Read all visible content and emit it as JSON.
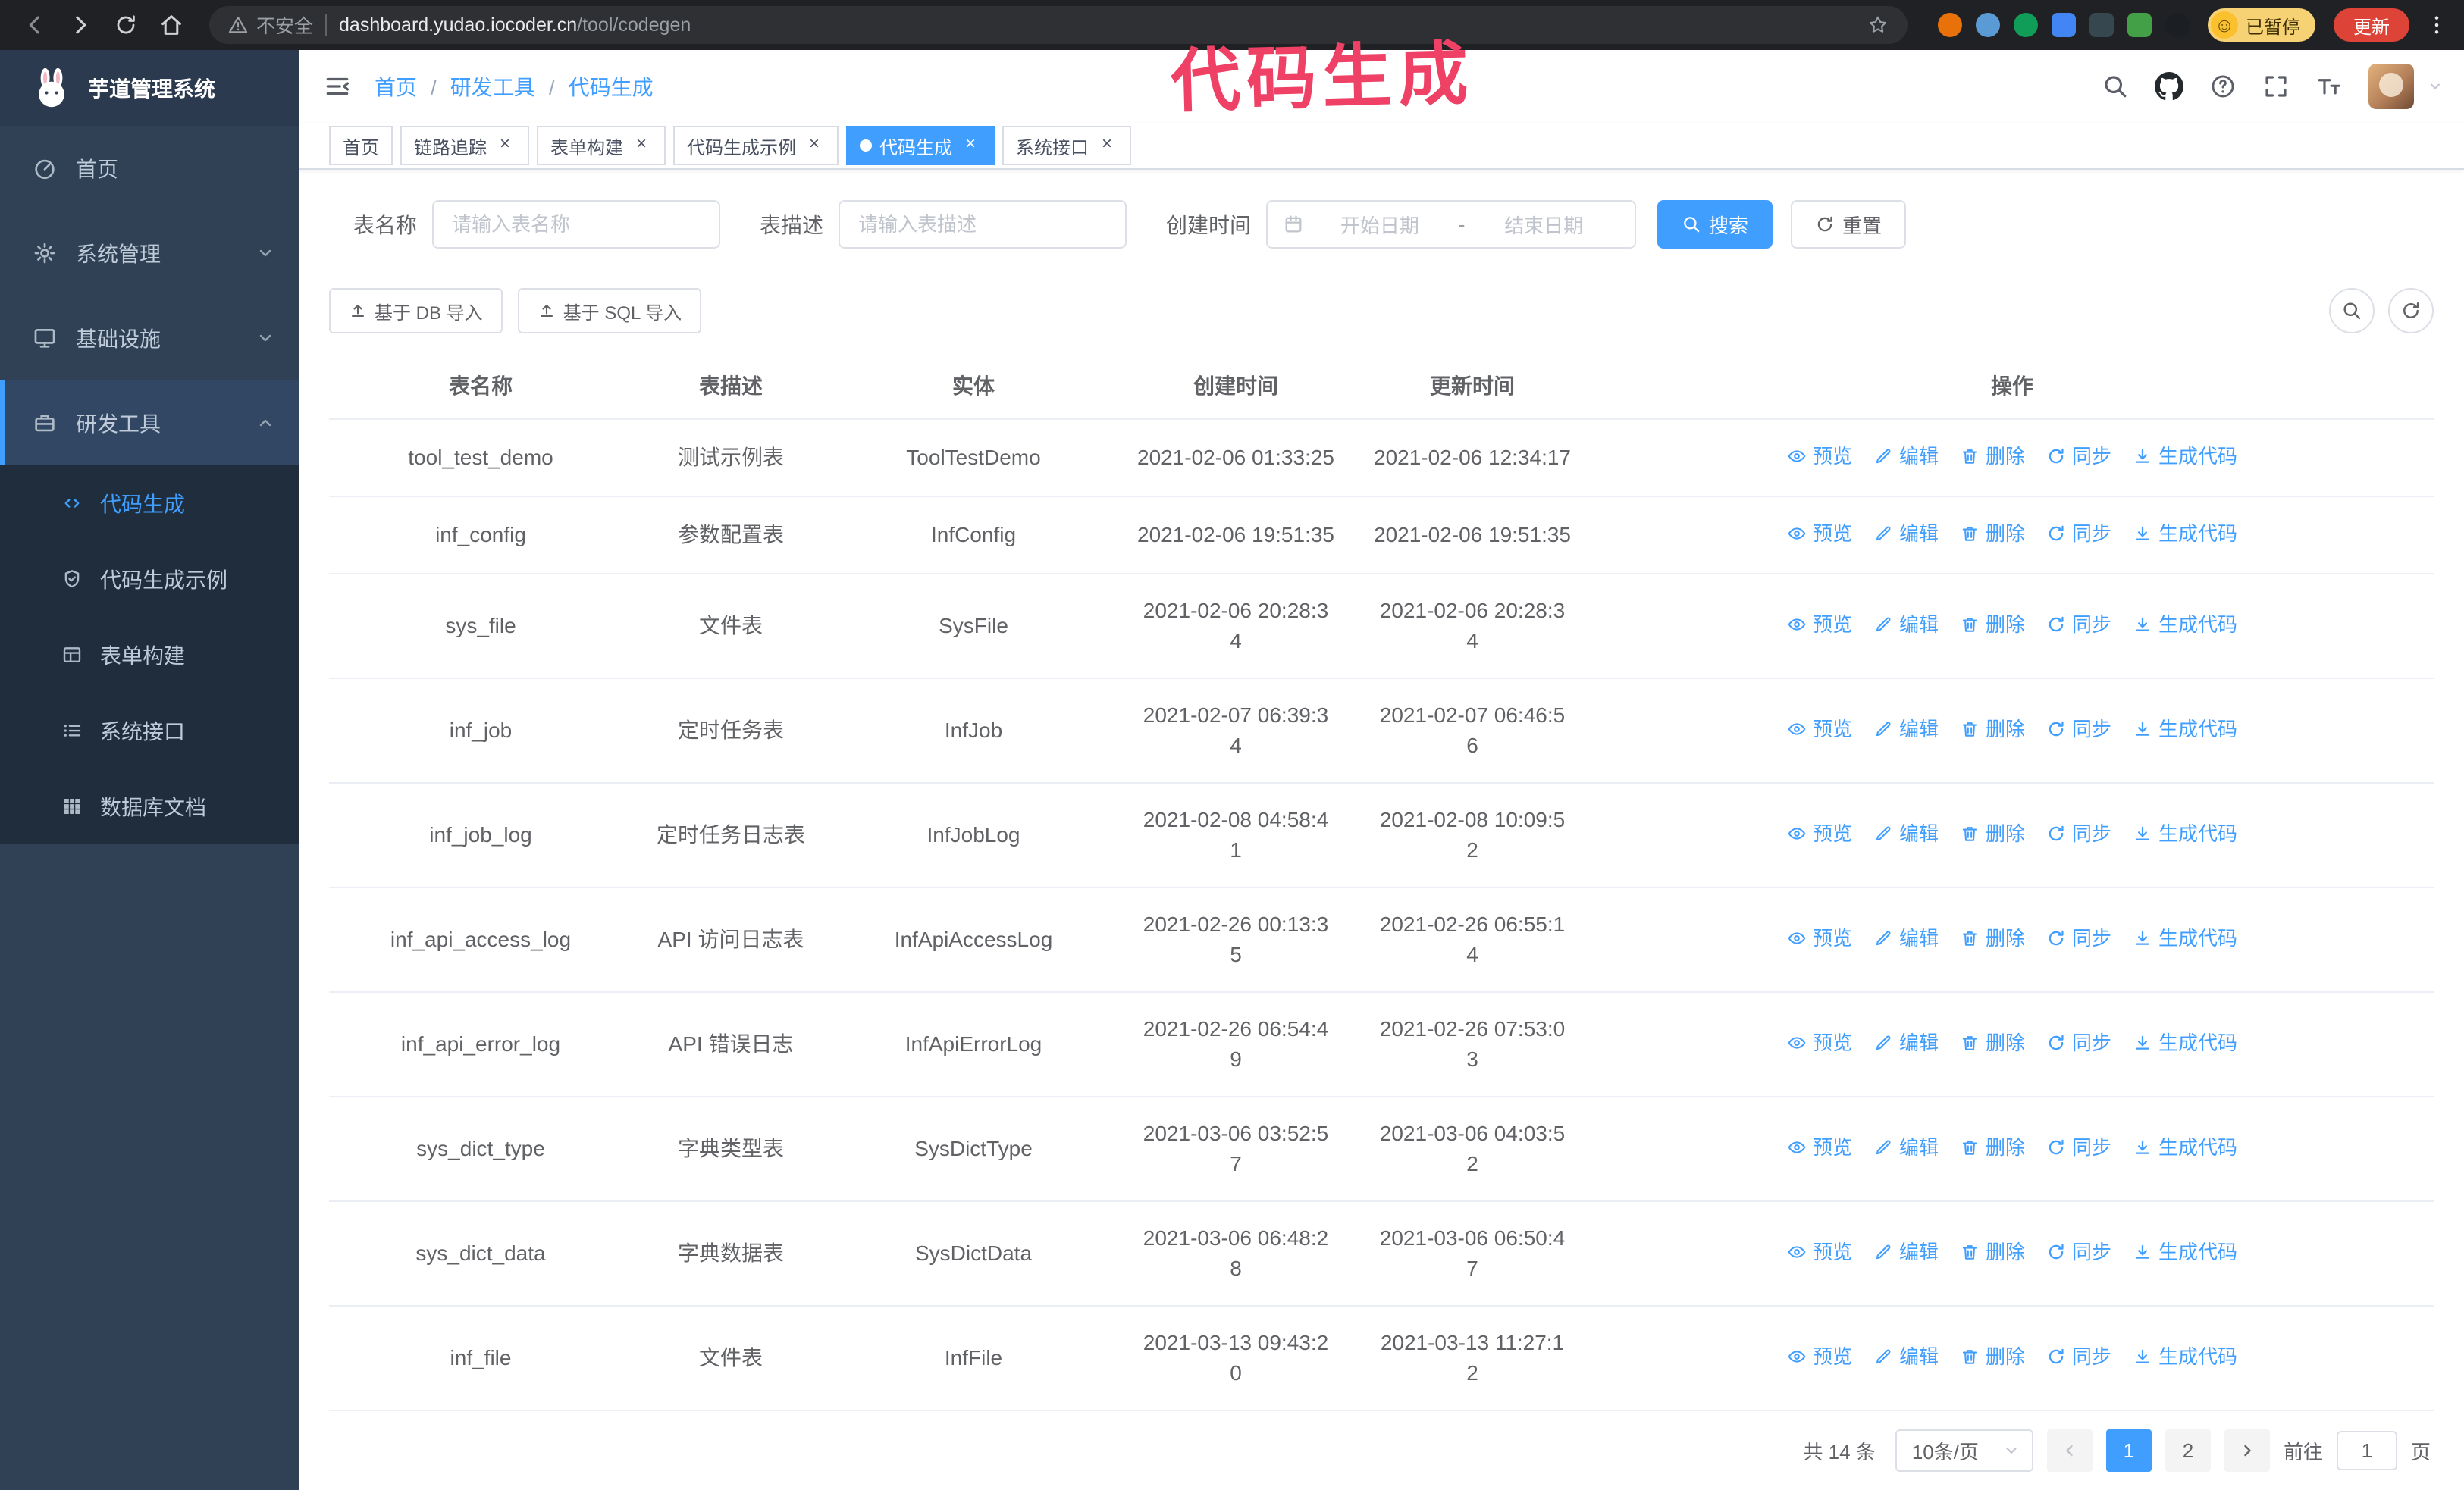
{
  "browser": {
    "security_label": "不安全",
    "url_host": "dashboard.yudao.iocoder.cn",
    "url_path": "/tool/codegen",
    "paused_badge": "已暂停",
    "update_button": "更新",
    "extensions": [
      {
        "name": "fox",
        "color": "#e8710a",
        "shape": "circle"
      },
      {
        "name": "drop",
        "color": "#5b9bd5",
        "shape": "circle"
      },
      {
        "name": "check",
        "color": "#0f9d58",
        "shape": "circle"
      },
      {
        "name": "people",
        "color": "#4285f4",
        "shape": "square"
      },
      {
        "name": "dark",
        "color": "#37474f",
        "shape": "square"
      },
      {
        "name": "leaf",
        "color": "#43a047",
        "shape": "square"
      },
      {
        "name": "knot",
        "color": "#1b1f23",
        "shape": "circle"
      }
    ]
  },
  "annotation": "代码生成",
  "sidebar": {
    "app_title": "芋道管理系统",
    "items": [
      {
        "key": "home",
        "label": "首页",
        "icon": "gauge"
      },
      {
        "key": "system",
        "label": "系统管理",
        "icon": "gear",
        "chevron": "down"
      },
      {
        "key": "infra",
        "label": "基础设施",
        "icon": "monitor",
        "chevron": "down"
      },
      {
        "key": "dev-tools",
        "label": "研发工具",
        "icon": "tools",
        "chevron": "up",
        "active": true
      }
    ],
    "submenu": [
      {
        "key": "codegen",
        "label": "代码生成",
        "icon": "code",
        "active": true
      },
      {
        "key": "codegen-example",
        "label": "代码生成示例",
        "icon": "shield"
      },
      {
        "key": "form-builder",
        "label": "表单构建",
        "icon": "tbl"
      },
      {
        "key": "api",
        "label": "系统接口",
        "icon": "list"
      },
      {
        "key": "db-doc",
        "label": "数据库文档",
        "icon": "grid"
      }
    ]
  },
  "header": {
    "breadcrumb": [
      "首页",
      "研发工具",
      "代码生成"
    ]
  },
  "tabs": [
    {
      "key": "home",
      "label": "首页",
      "closable": false,
      "active": false
    },
    {
      "key": "tracing",
      "label": "链路追踪",
      "closable": true,
      "active": false
    },
    {
      "key": "form-builder",
      "label": "表单构建",
      "closable": true,
      "active": false
    },
    {
      "key": "codegen-example",
      "label": "代码生成示例",
      "closable": true,
      "active": false
    },
    {
      "key": "codegen",
      "label": "代码生成",
      "closable": true,
      "active": true
    },
    {
      "key": "api",
      "label": "系统接口",
      "closable": true,
      "active": false
    }
  ],
  "filters": {
    "table_name_label": "表名称",
    "table_name_placeholder": "请输入表名称",
    "table_desc_label": "表描述",
    "table_desc_placeholder": "请输入表描述",
    "create_time_label": "创建时间",
    "date_start_placeholder": "开始日期",
    "date_separator": "-",
    "date_end_placeholder": "结束日期",
    "search_button": "搜索",
    "reset_button": "重置"
  },
  "toolbar": {
    "import_db_button": "基于 DB 导入",
    "import_sql_button": "基于 SQL 导入"
  },
  "table": {
    "columns": [
      "表名称",
      "表描述",
      "实体",
      "创建时间",
      "更新时间",
      "操作"
    ],
    "actions": [
      {
        "key": "preview",
        "label": "预览",
        "icon": "eye"
      },
      {
        "key": "edit",
        "label": "编辑",
        "icon": "edit"
      },
      {
        "key": "delete",
        "label": "删除",
        "icon": "trash"
      },
      {
        "key": "sync",
        "label": "同步",
        "icon": "sync"
      },
      {
        "key": "generate",
        "label": "生成代码",
        "icon": "download"
      }
    ],
    "rows": [
      {
        "name": "tool_test_demo",
        "description": "测试示例表",
        "entity": "ToolTestDemo",
        "create_time": "2021-02-06 01:33:25",
        "update_time": "2021-02-06 12:34:17"
      },
      {
        "name": "inf_config",
        "description": "参数配置表",
        "entity": "InfConfig",
        "create_time": "2021-02-06 19:51:35",
        "update_time": "2021-02-06 19:51:35"
      },
      {
        "name": "sys_file",
        "description": "文件表",
        "entity": "SysFile",
        "create_time": "2021-02-06 20:28:34",
        "update_time": "2021-02-06 20:28:34"
      },
      {
        "name": "inf_job",
        "description": "定时任务表",
        "entity": "InfJob",
        "create_time": "2021-02-07 06:39:34",
        "update_time": "2021-02-07 06:46:56"
      },
      {
        "name": "inf_job_log",
        "description": "定时任务日志表",
        "entity": "InfJobLog",
        "create_time": "2021-02-08 04:58:41",
        "update_time": "2021-02-08 10:09:52"
      },
      {
        "name": "inf_api_access_log",
        "description": "API 访问日志表",
        "entity": "InfApiAccessLog",
        "create_time": "2021-02-26 00:13:35",
        "update_time": "2021-02-26 06:55:14"
      },
      {
        "name": "inf_api_error_log",
        "description": "API 错误日志",
        "entity": "InfApiErrorLog",
        "create_time": "2021-02-26 06:54:49",
        "update_time": "2021-02-26 07:53:03"
      },
      {
        "name": "sys_dict_type",
        "description": "字典类型表",
        "entity": "SysDictType",
        "create_time": "2021-03-06 03:52:57",
        "update_time": "2021-03-06 04:03:52"
      },
      {
        "name": "sys_dict_data",
        "description": "字典数据表",
        "entity": "SysDictData",
        "create_time": "2021-03-06 06:48:28",
        "update_time": "2021-03-06 06:50:47"
      },
      {
        "name": "inf_file",
        "description": "文件表",
        "entity": "InfFile",
        "create_time": "2021-03-13 09:43:20",
        "update_time": "2021-03-13 11:27:12"
      }
    ]
  },
  "pagination": {
    "total_text": "共 14 条",
    "page_size": "10条/页",
    "pages": [
      "1",
      "2"
    ],
    "active_page": "1",
    "goto_prefix": "前往",
    "goto_value": "1",
    "goto_suffix": "页"
  }
}
